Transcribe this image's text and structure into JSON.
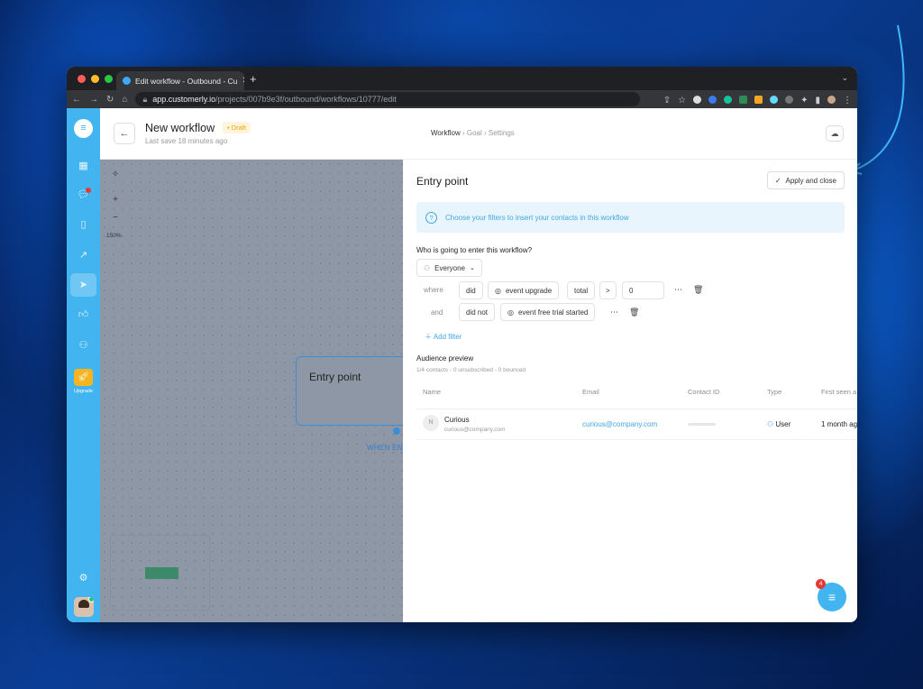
{
  "browser": {
    "tab_title": "Edit workflow - Outbound - Cu",
    "url_host": "app.customerly.io",
    "url_path": "/projects/007b9e3f/outbound/workflows/10777/edit"
  },
  "sidebar": {
    "logo": "≡",
    "upgrade_label": "Upgrade"
  },
  "header": {
    "title": "New workflow",
    "badge": "• Draft",
    "subtitle": "Last save 18 minutes ago",
    "breadcrumb": {
      "step1": "Workflow",
      "step2": "Goal",
      "step3": "Settings",
      "sep": " › "
    }
  },
  "canvas": {
    "zoom": "150%",
    "node_title": "Entry point",
    "node_label": "WHEN EN"
  },
  "panel": {
    "title": "Entry point",
    "apply_label": "Apply and close",
    "info_text": "Choose your filters to insert your contacts in this workflow",
    "question": "Who is going to enter this workflow?",
    "audience_select": "Everyone",
    "filter1": {
      "conj": "where",
      "verb": "did",
      "event": "event upgrade",
      "agg": "total",
      "op": ">",
      "value": "0"
    },
    "filter2": {
      "conj": "and",
      "verb": "did not",
      "event": "event free trial started"
    },
    "add_filter": "Add filter",
    "audience_title": "Audience preview",
    "audience_sub": "1/4 contacts - 0 unsubscribed - 0 bounced",
    "columns": [
      "Name",
      "Email",
      "Contact ID",
      "Type",
      "First seen a"
    ],
    "rows": [
      {
        "initial": "N",
        "name": "Curious",
        "name_email": "curious@company.com",
        "email": "curious@company.com",
        "type": "User",
        "first_seen": "1 month ag"
      }
    ]
  },
  "chat_launcher": {
    "badge": "4"
  },
  "colors": {
    "brand": "#42b4ef",
    "draft": "#f0a500",
    "link": "#42a6e6"
  }
}
